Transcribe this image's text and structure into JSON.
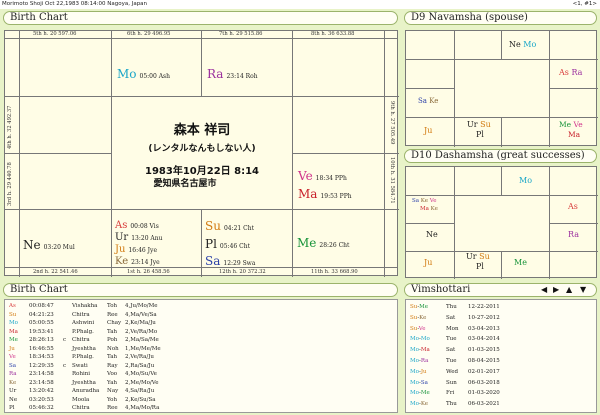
{
  "titlebar": {
    "left": "Morimoto Shoji Oct 22,1983 08:14:00  Nagoya, Japan",
    "right": "<1, #1>"
  },
  "panels": {
    "birth_chart": "Birth Chart",
    "d9": "D9 Navamsha  (spouse)",
    "d10": "D10 Dashamsha  (great successes)",
    "birth_table": "Birth Chart",
    "vimshottari": "Vimshottari"
  },
  "colors": {
    "Mo": "#1aa6c8",
    "Ra": "#9b2f9e",
    "Ve": "#d0338a",
    "Ma": "#c8202a",
    "As": "#d83a3a",
    "Ur": "#222222",
    "Ju": "#d27a10",
    "Ke": "#8a6a3a",
    "Su": "#d27a10",
    "Pl": "#222222",
    "Sa": "#2a3fa8",
    "Me": "#18943a",
    "Ne": "#222222"
  },
  "main_chart": {
    "houses": {
      "h5": "5th h.  20  597.06",
      "h6": "6th h.  29  496.95",
      "h7": "7th h.  29  515.86",
      "h8": "8th h.  36  633.88",
      "h4": "4th h.  32  492.37",
      "h9": "9th h.  27  505.49",
      "h3": "3rd h.  29  440.78",
      "h10": "10th h.  31  584.71",
      "h2": "2nd h.  22  541.46",
      "h1": "1st h.  26  458.56",
      "h12": "12th h.  20  372.32",
      "h11": "11th h.  33  668.90"
    },
    "planets": {
      "mo": {
        "n": "Mo",
        "d": "05:00  Ash"
      },
      "ra": {
        "n": "Ra",
        "d": "23:14  Roh"
      },
      "ve": {
        "n": "Ve",
        "d": "18:34  PPh"
      },
      "ma": {
        "n": "Ma",
        "d": "19:53  PPh"
      },
      "ne": {
        "n": "Ne",
        "d": "03:20  Mul"
      },
      "as": {
        "n": "As",
        "d": "00:08  Vis"
      },
      "ur": {
        "n": "Ur",
        "d": "13:20  Anu"
      },
      "ju": {
        "n": "Ju",
        "d": "16:46  Jye"
      },
      "ke": {
        "n": "Ke",
        "d": "23:14  Jye"
      },
      "su": {
        "n": "Su",
        "d": "04:21  Cht"
      },
      "pl": {
        "n": "Pl",
        "d": "05:46  Cht"
      },
      "sa": {
        "n": "Sa",
        "d": "12:29  Swa"
      },
      "me": {
        "n": "Me",
        "d": "28:26  Cht"
      }
    },
    "center": {
      "name": "森本 祥司",
      "nickname": "(レンタルなんもしない人)",
      "date": "1983年10月22日 8:14",
      "place": "愛知県名古屋市"
    }
  },
  "d9": {
    "ne_mo": [
      "Ne",
      "Mo"
    ],
    "as_ra": [
      "As",
      "Ra"
    ],
    "sa_ke": [
      "Sa",
      "Ke"
    ],
    "ju": "Ju",
    "ur_su": [
      "Ur",
      "Su"
    ],
    "pl": "Pl",
    "me_ve": [
      "Me",
      "Ve"
    ],
    "ma": "Ma"
  },
  "d10": {
    "mo": "Mo",
    "sa": "Sa",
    "ve": "Ve",
    "ma": "Ma",
    "ra": "Ra",
    "ke": "Ke",
    "as": "As",
    "ne": "Ne",
    "me": "Me",
    "ju": "Ju",
    "ur": "Ur",
    "su": "Su",
    "pl": "Pl",
    "ra2": "Ra"
  },
  "birth_table": [
    [
      "As",
      "00:08:47",
      "",
      "Vishakha",
      "Toh",
      "4,Ju/Mo/Me"
    ],
    [
      "Su",
      "04:21:23",
      "",
      "Chitra",
      "Ree",
      "4,Ma/Ve/Sa"
    ],
    [
      "Mo",
      "05:00:55",
      "",
      "Ashwini",
      "Chay",
      "2,Ke/Ma/Ju"
    ],
    [
      "Ma",
      "19:53:41",
      "",
      "P.Phalg.",
      "Tah",
      "2,Ve/Ra/Mo"
    ],
    [
      "Me",
      "28:26:13",
      "c",
      "Chitra",
      "Poh",
      "2,Ma/Sa/Me"
    ],
    [
      "Ju",
      "16:46:55",
      "",
      "Jyeshtha",
      "Noh",
      "1,Me/Me/Me"
    ],
    [
      "Ve",
      "18:34:53",
      "",
      "P.Phalg.",
      "Tah",
      "2,Ve/Ra/Ju"
    ],
    [
      "Sa",
      "12:29:35",
      "c",
      "Swati",
      "Ray",
      "2,Ra/Sa/Ju"
    ],
    [
      "Ra",
      "23:14:58",
      "",
      "Rohini",
      "Voo",
      "4,Mo/Su/Ve"
    ],
    [
      "Ke",
      "23:14:58",
      "",
      "Jyeshtha",
      "Yah",
      "2,Me/Mo/Ve"
    ],
    [
      "Ur",
      "13:20:42",
      "",
      "Anuradha",
      "Nay",
      "4,Sa/Ra/Ju"
    ],
    [
      "Ne",
      "03:20:53",
      "",
      "Moola",
      "Yoh",
      "2,Ke/Su/Sa"
    ],
    [
      "Pl",
      "05:46:32",
      "",
      "Chitra",
      "Ree",
      "4,Ma/Mo/Ra"
    ]
  ],
  "vimshottari": [
    [
      "Su-Me",
      "Thu",
      "12-22-2011",
      "Su",
      "Me"
    ],
    [
      "Su-Ke",
      "Sat",
      "10-27-2012",
      "Su",
      "Ke"
    ],
    [
      "Su-Ve",
      "Mon",
      "03-04-2013",
      "Su",
      "Ve"
    ],
    [
      "Mo-Mo",
      "Tue",
      "03-04-2014",
      "Mo",
      "Mo"
    ],
    [
      "Mo-Ma",
      "Sat",
      "01-03-2015",
      "Mo",
      "Ma"
    ],
    [
      "Mo-Ra",
      "Tue",
      "08-04-2015",
      "Mo",
      "Ra"
    ],
    [
      "Mo-Ju",
      "Wed",
      "02-01-2017",
      "Mo",
      "Ju"
    ],
    [
      "Mo-Sa",
      "Sun",
      "06-03-2018",
      "Mo",
      "Sa"
    ],
    [
      "Mo-Me",
      "Fri",
      "01-03-2020",
      "Mo",
      "Me"
    ],
    [
      "Mo-Ke",
      "Thu",
      "06-03-2021",
      "Mo",
      "Ke"
    ]
  ],
  "nav_icons": [
    "triangle-left-icon",
    "triangle-right-icon",
    "triangle-up-icon",
    "triangle-down-icon"
  ],
  "nav_glyphs": [
    "◀",
    "▶",
    "▲",
    "▼"
  ]
}
